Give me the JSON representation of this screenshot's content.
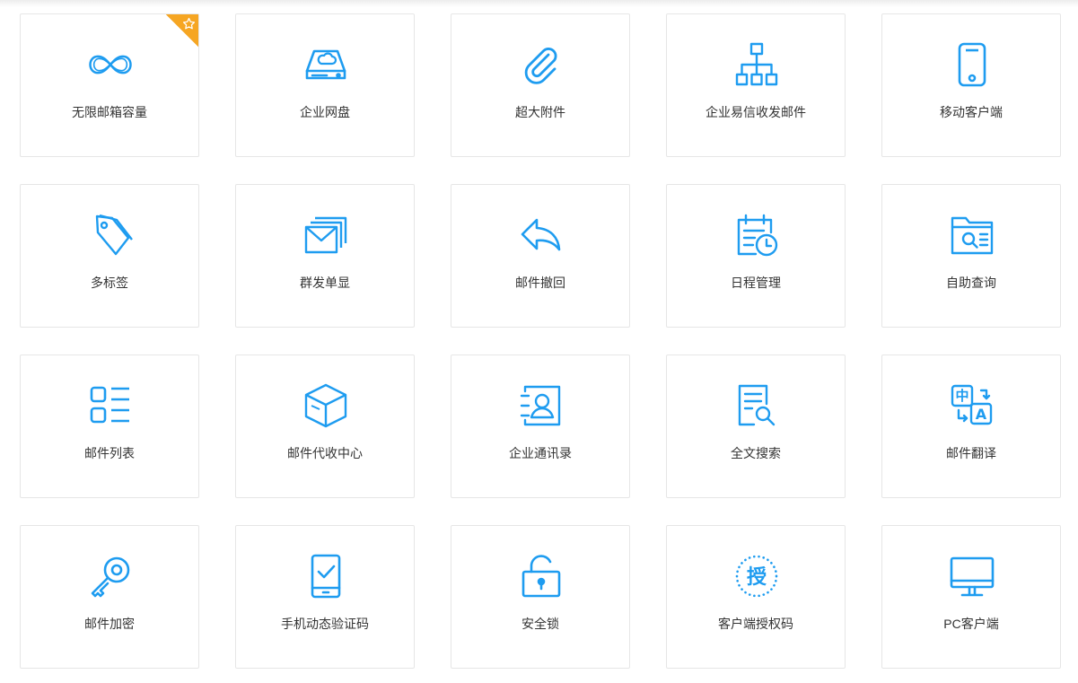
{
  "features": [
    {
      "label": "无限邮箱容量",
      "icon": "infinity-icon",
      "badge": "star-badge-icon"
    },
    {
      "label": "企业网盘",
      "icon": "cloud-drive-icon"
    },
    {
      "label": "超大附件",
      "icon": "paperclip-icon"
    },
    {
      "label": "企业易信收发邮件",
      "icon": "org-chart-icon"
    },
    {
      "label": "移动客户端",
      "icon": "mobile-phone-icon"
    },
    {
      "label": "多标签",
      "icon": "tag-icon"
    },
    {
      "label": "群发单显",
      "icon": "stacked-mail-icon"
    },
    {
      "label": "邮件撤回",
      "icon": "undo-arrow-icon"
    },
    {
      "label": "日程管理",
      "icon": "calendar-clock-icon"
    },
    {
      "label": "自助查询",
      "icon": "folder-search-icon"
    },
    {
      "label": "邮件列表",
      "icon": "list-icon"
    },
    {
      "label": "邮件代收中心",
      "icon": "package-box-icon"
    },
    {
      "label": "企业通讯录",
      "icon": "contacts-book-icon"
    },
    {
      "label": "全文搜索",
      "icon": "document-search-icon"
    },
    {
      "label": "邮件翻译",
      "icon": "translate-icon",
      "icon_text": [
        "中",
        "A"
      ]
    },
    {
      "label": "邮件加密",
      "icon": "key-icon"
    },
    {
      "label": "手机动态验证码",
      "icon": "phone-check-icon"
    },
    {
      "label": "安全锁",
      "icon": "padlock-icon"
    },
    {
      "label": "客户端授权码",
      "icon": "authorization-icon",
      "icon_text": [
        "授"
      ]
    },
    {
      "label": "PC客户端",
      "icon": "monitor-icon"
    }
  ],
  "colors": {
    "accent": "#1e9cf0",
    "badge": "#f6a623",
    "border": "#e6e6e6",
    "text": "#333333"
  }
}
